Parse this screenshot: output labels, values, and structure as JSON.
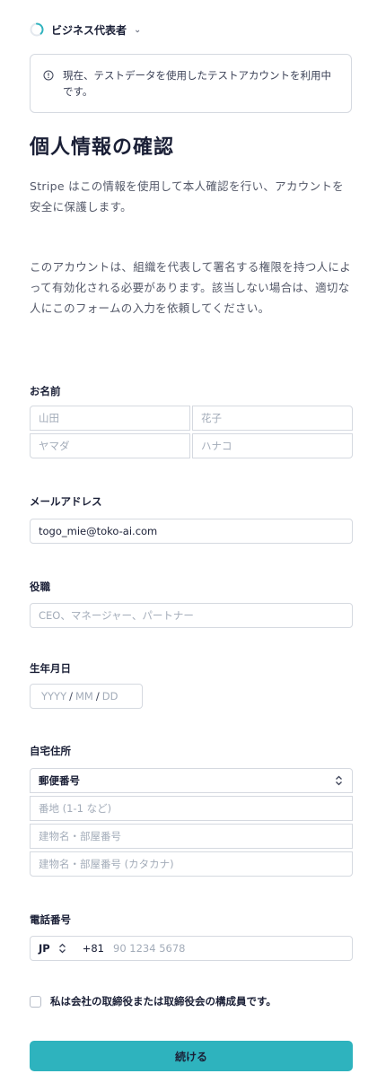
{
  "header": {
    "step_label": "ビジネス代表者"
  },
  "notice": {
    "text": "現在、テストデータを使用したテストアカウントを利用中です。"
  },
  "title": "個人情報の確認",
  "intro": "Stripe はこの情報を使用して本人確認を行い、アカウントを安全に保護します。",
  "authority_note": "このアカウントは、組織を代表して署名する権限を持つ人によって有効化される必要があります。該当しない場合は、適切な人にこのフォームの入力を依頼してください。",
  "name": {
    "label": "お名前",
    "last_placeholder": "山田",
    "first_placeholder": "花子",
    "last_kana_placeholder": "ヤマダ",
    "first_kana_placeholder": "ハナコ"
  },
  "email": {
    "label": "メールアドレス",
    "value": "togo_mie@toko-ai.com"
  },
  "job_title": {
    "label": "役職",
    "placeholder": "CEO、マネージャー、パートナー"
  },
  "dob": {
    "label": "生年月日",
    "yyyy": "YYYY",
    "mm": "MM",
    "dd": "DD",
    "sep": "/"
  },
  "address": {
    "label": "自宅住所",
    "postal_select": "郵便番号",
    "line1_placeholder": "番地 (1-1 など)",
    "line2_placeholder": "建物名・部屋番号",
    "line2_kana_placeholder": "建物名・部屋番号 (カタカナ)"
  },
  "phone": {
    "label": "電話番号",
    "country": "JP",
    "prefix": "+81",
    "placeholder": "90 1234 5678"
  },
  "director_checkbox": {
    "label": "私は会社の取締役または取締役会の構成員です。",
    "checked": false
  },
  "continue_button": "続ける",
  "colors": {
    "accent": "#2eb3be",
    "spinner": "#2eb3be",
    "border": "#d5d9e0"
  }
}
